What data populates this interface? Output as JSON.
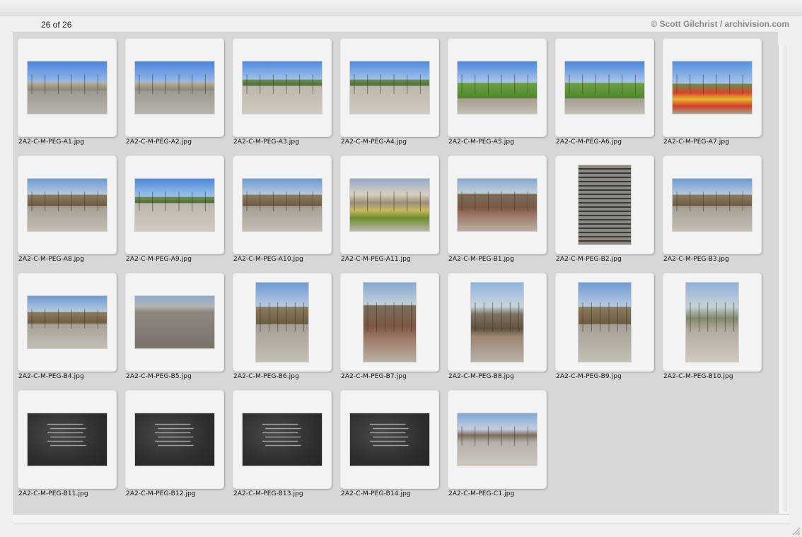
{
  "header": {
    "counter": "26 of 26",
    "copyright": "© Scott Gilchrist / archivision.com"
  },
  "thumbnails": [
    {
      "name": "2A2-C-M-PEG-A1.jpg",
      "orientation": "landscape",
      "scene": "street"
    },
    {
      "name": "2A2-C-M-PEG-A2.jpg",
      "orientation": "landscape",
      "scene": "street"
    },
    {
      "name": "2A2-C-M-PEG-A3.jpg",
      "orientation": "landscape",
      "scene": "plaza"
    },
    {
      "name": "2A2-C-M-PEG-A4.jpg",
      "orientation": "landscape",
      "scene": "plaza"
    },
    {
      "name": "2A2-C-M-PEG-A5.jpg",
      "orientation": "landscape",
      "scene": "grass"
    },
    {
      "name": "2A2-C-M-PEG-A6.jpg",
      "orientation": "landscape",
      "scene": "grass"
    },
    {
      "name": "2A2-C-M-PEG-A7.jpg",
      "orientation": "landscape",
      "scene": "tulip"
    },
    {
      "name": "2A2-C-M-PEG-A8.jpg",
      "orientation": "landscape",
      "scene": "park"
    },
    {
      "name": "2A2-C-M-PEG-A9.jpg",
      "orientation": "landscape",
      "scene": "plaza"
    },
    {
      "name": "2A2-C-M-PEG-A10.jpg",
      "orientation": "landscape",
      "scene": "park"
    },
    {
      "name": "2A2-C-M-PEG-A11.jpg",
      "orientation": "landscape",
      "scene": "yellow"
    },
    {
      "name": "2A2-C-M-PEG-B1.jpg",
      "orientation": "landscape",
      "scene": "parkred"
    },
    {
      "name": "2A2-C-M-PEG-B2.jpg",
      "orientation": "portrait",
      "scene": "steps"
    },
    {
      "name": "2A2-C-M-PEG-B3.jpg",
      "orientation": "landscape",
      "scene": "park"
    },
    {
      "name": "2A2-C-M-PEG-B4.jpg",
      "orientation": "landscape",
      "scene": "park"
    },
    {
      "name": "2A2-C-M-PEG-B5.jpg",
      "orientation": "landscape",
      "scene": "b5"
    },
    {
      "name": "2A2-C-M-PEG-B6.jpg",
      "orientation": "portrait",
      "scene": "park"
    },
    {
      "name": "2A2-C-M-PEG-B7.jpg",
      "orientation": "portrait",
      "scene": "parkred"
    },
    {
      "name": "2A2-C-M-PEG-B8.jpg",
      "orientation": "portrait",
      "scene": "tall"
    },
    {
      "name": "2A2-C-M-PEG-B9.jpg",
      "orientation": "portrait",
      "scene": "park"
    },
    {
      "name": "2A2-C-M-PEG-B10.jpg",
      "orientation": "portrait",
      "scene": "wall"
    },
    {
      "name": "2A2-C-M-PEG-B11.jpg",
      "orientation": "landscape",
      "scene": "stone"
    },
    {
      "name": "2A2-C-M-PEG-B12.jpg",
      "orientation": "landscape",
      "scene": "stone"
    },
    {
      "name": "2A2-C-M-PEG-B13.jpg",
      "orientation": "landscape",
      "scene": "stone"
    },
    {
      "name": "2A2-C-M-PEG-B14.jpg",
      "orientation": "landscape",
      "scene": "stone"
    },
    {
      "name": "2A2-C-M-PEG-C1.jpg",
      "orientation": "landscape",
      "scene": "c1"
    }
  ],
  "colors": {
    "background": "#d7d7d7",
    "slide_mount": "#f3f3f3",
    "copyright_text": "#8a8a8a"
  }
}
